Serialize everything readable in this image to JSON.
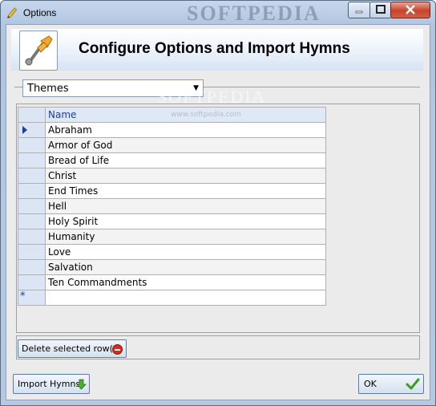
{
  "window": {
    "title": "Options",
    "watermark": "SOFTPEDIA",
    "watermark_url": "www.softpedia.com"
  },
  "header": {
    "title": "Configure Options and Import Hymns",
    "icon": "tools-icon"
  },
  "category_select": {
    "value": "Themes"
  },
  "grid": {
    "column_header": "Name",
    "rows": [
      "Abraham",
      "Armor of God",
      "Bread of Life",
      "Christ",
      "End Times",
      "Hell",
      "Holy Spirit",
      "Humanity",
      "Love",
      "Salvation",
      "Ten Commandments"
    ],
    "new_row_marker": "*"
  },
  "buttons": {
    "delete": "Delete selected row(s)",
    "import": "Import Hymns",
    "ok": "OK"
  },
  "colors": {
    "accent": "#1a3ea8",
    "frame": "#b6c9e2",
    "close": "#c7432b"
  }
}
